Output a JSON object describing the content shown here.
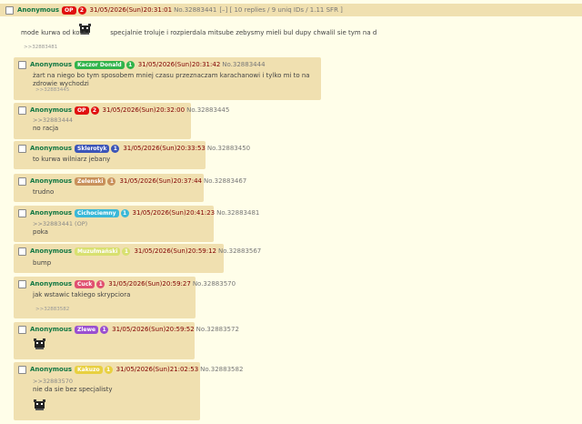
{
  "op": {
    "name": "Anonymous",
    "tag": "OP",
    "tag_color": "#e01010",
    "count": "2",
    "count_color": "#e01010",
    "datetime": "31/05/2026(Sun)20:31:01",
    "post_no": "No.32883441",
    "thread_meta": "[–] [ 10 replies / 9 uniq IDs / 1.11 SFR ]",
    "text_before": "mode kurwa od kota i",
    "text_after": "specjalnie troluje i rozpierdala mitsube zebysmy mieli bul dupy chwalil sie tym na d",
    "backlinks": ">>32883481"
  },
  "replies": [
    {
      "name": "Anonymous",
      "tag": "Kaczor Donald",
      "tag_color": "#31b34a",
      "count": "1",
      "count_color": "#31b34a",
      "datetime": "31/05/2026(Sun)20:31:42",
      "post_no": "No.32883444",
      "quote": "",
      "text": "żart na niego bo tym sposobem mniej czasu przeznaczam karachanowi i tylko mi to na zdrowie wychodzi",
      "backlinks": ">>32883445",
      "has_image": false
    },
    {
      "name": "Anonymous",
      "tag": "OP",
      "tag_color": "#e01010",
      "count": "2",
      "count_color": "#e01010",
      "datetime": "31/05/2026(Sun)20:32:00",
      "post_no": "No.32883445",
      "quote": ">>32883444",
      "text": "no racja",
      "backlinks": "",
      "has_image": false
    },
    {
      "name": "Anonymous",
      "tag": "Sklerotyk",
      "tag_color": "#3c55b8",
      "count": "1",
      "count_color": "#3c55b8",
      "datetime": "31/05/2026(Sun)20:33:53",
      "post_no": "No.32883450",
      "quote": "",
      "text": "to kurwa wilniarz jebany",
      "backlinks": "",
      "has_image": false
    },
    {
      "name": "Anonymous",
      "tag": "Zelenski",
      "tag_color": "#c8905a",
      "count": "1",
      "count_color": "#c8905a",
      "datetime": "31/05/2026(Sun)20:37:44",
      "post_no": "No.32883467",
      "quote": "",
      "text": "trudno",
      "backlinks": "",
      "has_image": false
    },
    {
      "name": "Anonymous",
      "tag": "Cichociemny",
      "tag_color": "#3ab8d8",
      "count": "1",
      "count_color": "#3ab8d8",
      "datetime": "31/05/2026(Sun)20:41:23",
      "post_no": "No.32883481",
      "quote": ">>32883441 (OP)",
      "text": "poka",
      "backlinks": "",
      "has_image": false
    },
    {
      "name": "Anonymous",
      "tag": "Muzułmański",
      "tag_color": "#d8e070",
      "count": "1",
      "count_color": "#d8e070",
      "datetime": "31/05/2026(Sun)20:59:12",
      "post_no": "No.32883567",
      "quote": "",
      "text": "bump",
      "backlinks": "",
      "has_image": false
    },
    {
      "name": "Anonymous",
      "tag": "Cuck",
      "tag_color": "#e05070",
      "count": "1",
      "count_color": "#e05070",
      "datetime": "31/05/2026(Sun)20:59:27",
      "post_no": "No.32883570",
      "quote": "",
      "text": "jak wstawic takiego skrypciora",
      "backlinks": ">>32883582",
      "has_image": false
    },
    {
      "name": "Anonymous",
      "tag": "Zlewe",
      "tag_color": "#9a4fd0",
      "count": "1",
      "count_color": "#9a4fd0",
      "datetime": "31/05/2026(Sun)20:59:52",
      "post_no": "No.32883572",
      "quote": "",
      "text": "",
      "backlinks": "",
      "has_image": true
    },
    {
      "name": "Anonymous",
      "tag": "Kakuzo",
      "tag_color": "#e8d040",
      "count": "1",
      "count_color": "#e8d040",
      "datetime": "31/05/2026(Sun)21:02:53",
      "post_no": "No.32883582",
      "quote": ">>32883570",
      "text": "nie da sie bez specjalisty",
      "backlinks": "",
      "has_image": true
    }
  ]
}
